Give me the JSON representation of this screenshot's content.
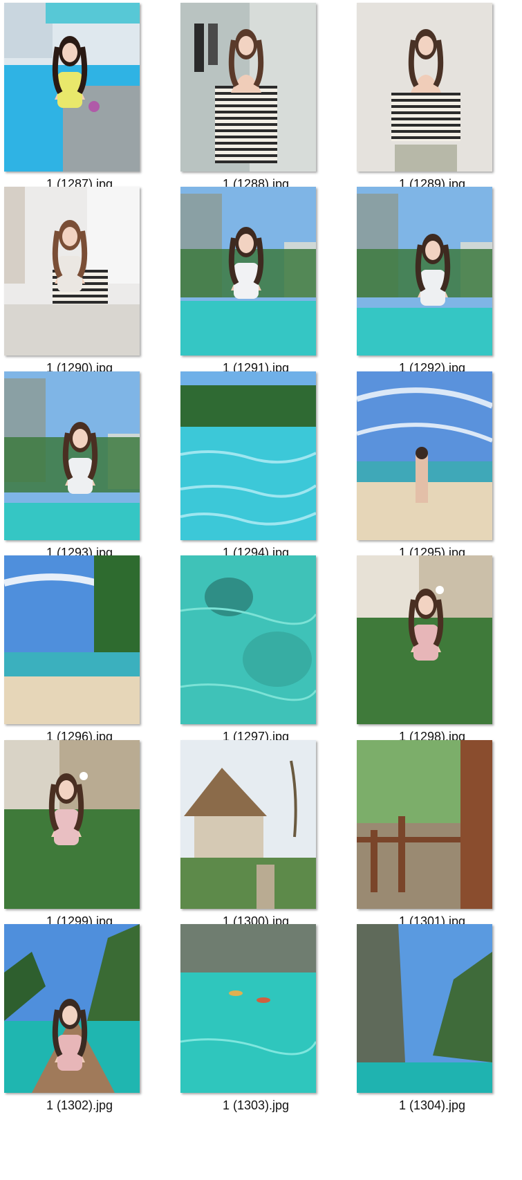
{
  "files": [
    {
      "name": "1 (1287).jpg",
      "scene": "pool-bikini"
    },
    {
      "name": "1 (1288).jpg",
      "scene": "striped-top-closet"
    },
    {
      "name": "1 (1289).jpg",
      "scene": "striped-top-wall"
    },
    {
      "name": "1 (1290).jpg",
      "scene": "seated-room"
    },
    {
      "name": "1 (1291).jpg",
      "scene": "infinity-pool-front"
    },
    {
      "name": "1 (1292).jpg",
      "scene": "infinity-pool-side"
    },
    {
      "name": "1 (1293).jpg",
      "scene": "infinity-pool-back"
    },
    {
      "name": "1 (1294).jpg",
      "scene": "pool-water"
    },
    {
      "name": "1 (1295).jpg",
      "scene": "beach-kneeling"
    },
    {
      "name": "1 (1296).jpg",
      "scene": "beach-shore"
    },
    {
      "name": "1 (1297).jpg",
      "scene": "clear-sea"
    },
    {
      "name": "1 (1298).jpg",
      "scene": "pink-dress-garden"
    },
    {
      "name": "1 (1299).jpg",
      "scene": "pink-dress-bungalow"
    },
    {
      "name": "1 (1300).jpg",
      "scene": "thatched-bungalow"
    },
    {
      "name": "1 (1301).jpg",
      "scene": "wooden-stairs"
    },
    {
      "name": "1 (1302).jpg",
      "scene": "longtail-boat"
    },
    {
      "name": "1 (1303).jpg",
      "scene": "lagoon-kayaks"
    },
    {
      "name": "1 (1304).jpg",
      "scene": "limestone-cliffs"
    }
  ],
  "colors": {
    "water": "#35c6c4",
    "sky": "#5f9fe0",
    "foliage": "#3f7a3a",
    "sand": "#e6d6b8",
    "background": "#ffffff"
  }
}
